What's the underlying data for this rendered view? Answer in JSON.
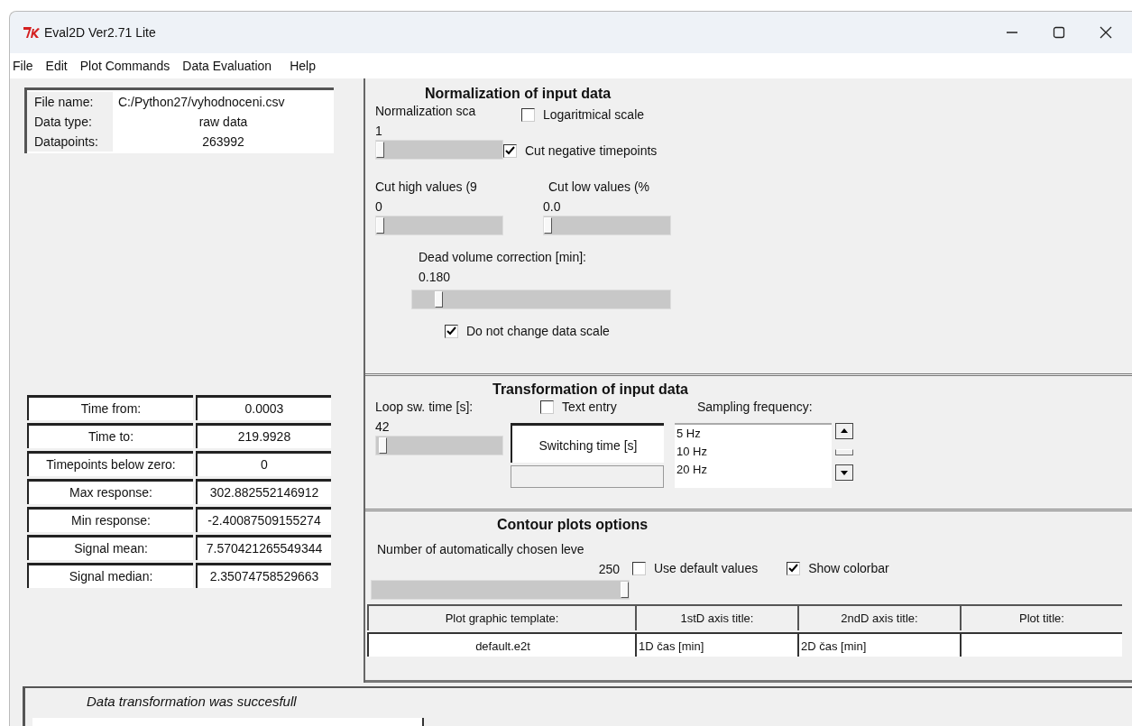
{
  "window": {
    "title": "Eval2D Ver2.71 Lite"
  },
  "menu": [
    "File",
    "Edit",
    "Plot Commands",
    "Data Evaluation",
    "Help"
  ],
  "file_info": [
    {
      "label": "File name:",
      "value": "C:/Python27/vyhodnoceni.csv"
    },
    {
      "label": "Data type:",
      "value": "raw data"
    },
    {
      "label": "Datapoints:",
      "value": "263992"
    }
  ],
  "statistics": [
    {
      "label": "Time from:",
      "value": "0.0003"
    },
    {
      "label": "Time to:",
      "value": "219.9928"
    },
    {
      "label": "Timepoints below zero:",
      "value": "0"
    },
    {
      "label": "Max response:",
      "value": "302.882552146912"
    },
    {
      "label": "Min response:",
      "value": "-2.40087509155274"
    },
    {
      "label": "Signal mean:",
      "value": "7.570421265549344"
    },
    {
      "label": "Signal median:",
      "value": "2.35074758529663"
    }
  ],
  "normalization": {
    "title": "Normalization of input data",
    "scale": {
      "label": "Normalization sca",
      "value": "1",
      "level": 0
    },
    "log_scale": {
      "label": "Logaritmical scale",
      "checked": false
    },
    "cut_negative": {
      "label": "Cut negative timepoints",
      "checked": true
    },
    "cut_high": {
      "label": "Cut high values (9",
      "value": "0",
      "level": 0
    },
    "cut_low": {
      "label": "Cut low values (%",
      "value": "0.0",
      "level": 0
    },
    "dead_volume": {
      "label": "Dead volume correction [min]:",
      "value": "0.180",
      "level": 0.09
    },
    "keep_scale": {
      "label": "Do not change data scale",
      "checked": true
    }
  },
  "transformation": {
    "title": "Transformation of input data",
    "loop_time": {
      "label": "Loop sw. time [s]:",
      "value": "42",
      "level": 0.02
    },
    "text_entry": {
      "label": "Text entry",
      "checked": false
    },
    "switching_time": {
      "label": "Switching time [s]"
    },
    "sampling": {
      "label": "Sampling frequency:",
      "options": [
        "5 Hz",
        "10 Hz",
        "20 Hz"
      ]
    }
  },
  "contour": {
    "title": "Contour plots options",
    "levels": {
      "label": "Number of automatically chosen leve",
      "value": "250",
      "level": 1
    },
    "use_default": {
      "label": "Use default values",
      "checked": false
    },
    "show_colorbar": {
      "label": "Show colorbar",
      "checked": true
    },
    "columns": [
      {
        "header": "Plot graphic template:",
        "value": "default.e2t"
      },
      {
        "header": "1stD axis title:",
        "value": "1D čas [min]"
      },
      {
        "header": "2ndD axis title:",
        "value": "2D čas [min]"
      },
      {
        "header": "Plot title:"
      }
    ]
  },
  "status": {
    "message": "Data transformation was succesfull"
  }
}
